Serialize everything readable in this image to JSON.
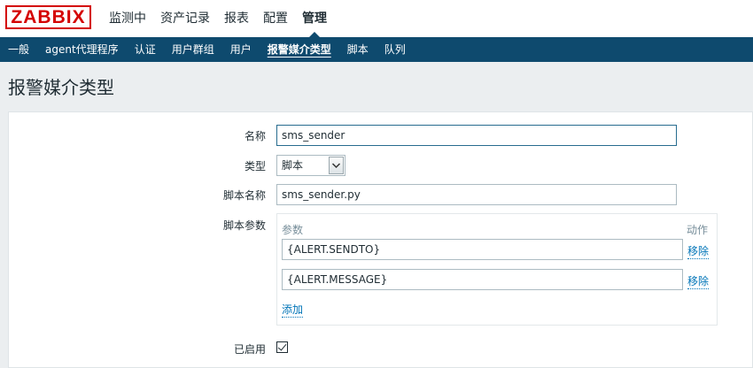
{
  "logo": "ZABBIX",
  "top_nav": [
    "监测中",
    "资产记录",
    "报表",
    "配置",
    "管理"
  ],
  "top_nav_active": "管理",
  "sub_nav": [
    "一般",
    "agent代理程序",
    "认证",
    "用户群组",
    "用户",
    "报警媒介类型",
    "脚本",
    "队列"
  ],
  "sub_nav_active": "报警媒介类型",
  "page_title": "报警媒介类型",
  "form": {
    "name_label": "名称",
    "name_value": "sms_sender",
    "type_label": "类型",
    "type_value": "脚本",
    "script_name_label": "脚本名称",
    "script_name_value": "sms_sender.py",
    "script_params_label": "脚本参数",
    "params_header": "参数",
    "action_header": "动作",
    "params": [
      {
        "value": "{ALERT.SENDTO}",
        "remove": "移除"
      },
      {
        "value": "{ALERT.MESSAGE}",
        "remove": "移除"
      }
    ],
    "add_label": "添加",
    "enabled_label": "已启用",
    "enabled": true
  }
}
